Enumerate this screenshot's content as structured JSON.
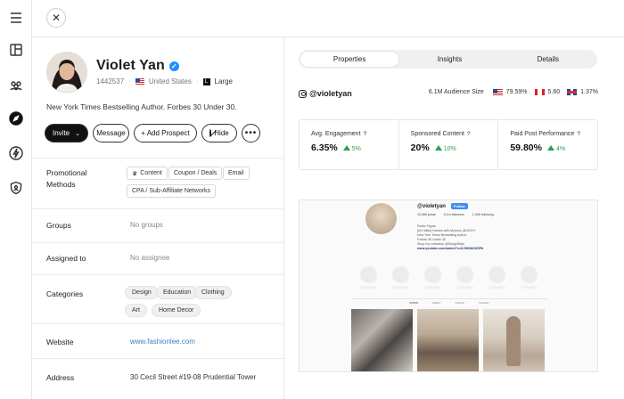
{
  "rail": {
    "icons": [
      "menu-icon",
      "layout-icon",
      "users-icon",
      "compass-icon",
      "lightning-icon",
      "shield-icon"
    ]
  },
  "topbar": {
    "close_glyph": "✕"
  },
  "profile": {
    "name": "Violet Yan",
    "id": "1442537",
    "country": "United States",
    "size": "Large",
    "bio": "New York Times Bestselling Author. Forbes 30 Under 30."
  },
  "actions": {
    "invite": "Invite",
    "message": "Message",
    "add_prospect": "+ Add Prospect",
    "hide": "Hide",
    "more": "•••"
  },
  "rows": {
    "promotional": {
      "label": "Promotional Methods",
      "chips": [
        "Content",
        "Coupon / Deals",
        "Email",
        "CPA / Sub-Affiliate Networks"
      ]
    },
    "groups": {
      "label": "Groups",
      "value": "No groups"
    },
    "assigned": {
      "label": "Assigned to",
      "value": "No assignee"
    },
    "categories": {
      "label": "Categories",
      "items": [
        "Design",
        "Education",
        "Clothing",
        "Art",
        "Home Decor"
      ]
    },
    "website": {
      "label": "Website",
      "value": "www.fashionlee.com"
    },
    "address": {
      "label": "Address",
      "value": "30 Cecil Street #19-08 Prudential Tower"
    }
  },
  "tabs": [
    "Properties",
    "Insights",
    "Details"
  ],
  "instagram": {
    "handle": "@violetyan",
    "audience_label": "6.1M Audience Size",
    "countries": [
      {
        "flag": "us",
        "pct": "79.59%"
      },
      {
        "flag": "ca",
        "pct": "5.60"
      },
      {
        "flag": "uk",
        "pct": "1.37%"
      }
    ]
  },
  "stats": [
    {
      "title": "Avg. Engagement",
      "help": "?",
      "value": "6.35%",
      "delta": "5%"
    },
    {
      "title": "Sponsored Content",
      "help": "?",
      "value": "20%",
      "delta": "10%"
    },
    {
      "title": "Paid Post Performance",
      "help": "?",
      "value": "59.80%",
      "delta": "4%"
    }
  ],
  "preview": {
    "handle": "@violetyan",
    "follow": "Follow",
    "posts": "10,069 posts",
    "followers": "5.1m followers",
    "following": "1,006 following",
    "bio_lines": [
      "Public Figure",
      "[Art+Mike] Homes with Mommy @VIOYY",
      "New York Times Bestselling Author",
      "Forbes 30 Under 30",
      "Shop my collection @SongsStyle"
    ],
    "link": "www.youtube.com/watch?v=KJ9K9kDSSPA",
    "tabs": [
      "POSTS",
      "REELS",
      "VIDEOS",
      "TAGGED"
    ]
  }
}
